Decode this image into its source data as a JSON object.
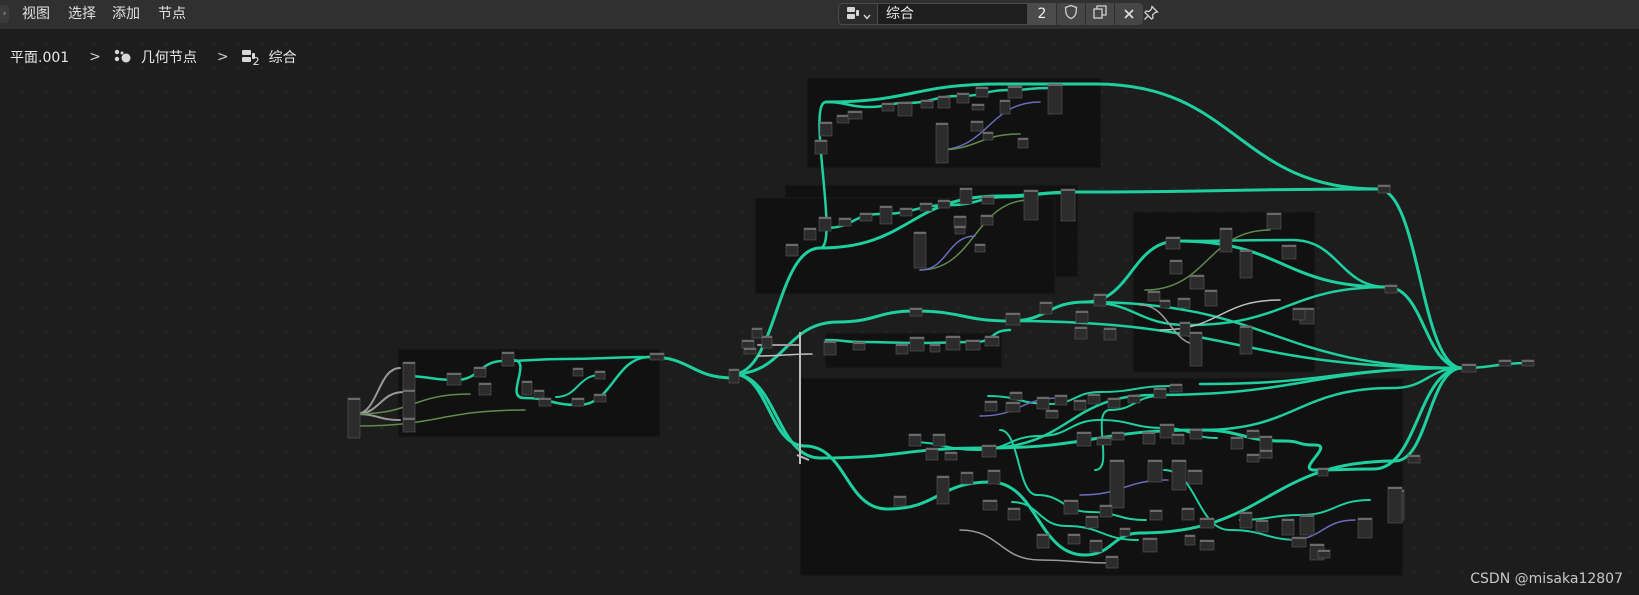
{
  "header": {
    "menu": [
      "视图",
      "选择",
      "添加",
      "节点"
    ],
    "node_tree": {
      "name": "综合",
      "user_count": "2",
      "type_icon": "node-tree-icon",
      "buttons": [
        "fake-user-shield-icon",
        "duplicate-icon",
        "close-icon"
      ]
    },
    "pin_icon": "pin-icon"
  },
  "breadcrumb": {
    "items": [
      "平面.001",
      "几何节点",
      "综合"
    ],
    "group_level": "2",
    "separator": ">"
  },
  "colors": {
    "background": "#1d1d1d",
    "header": "#303030",
    "frame": "#111111",
    "node": "#2c2c2c",
    "link_geometry": "#1fcf9f",
    "link_float": "#9a9a9a",
    "link_vector": "#6b6bbf",
    "link_field": "#5f8d4e",
    "link_string": "#c0c0c0"
  },
  "watermark": "CSDN @misaka12807"
}
